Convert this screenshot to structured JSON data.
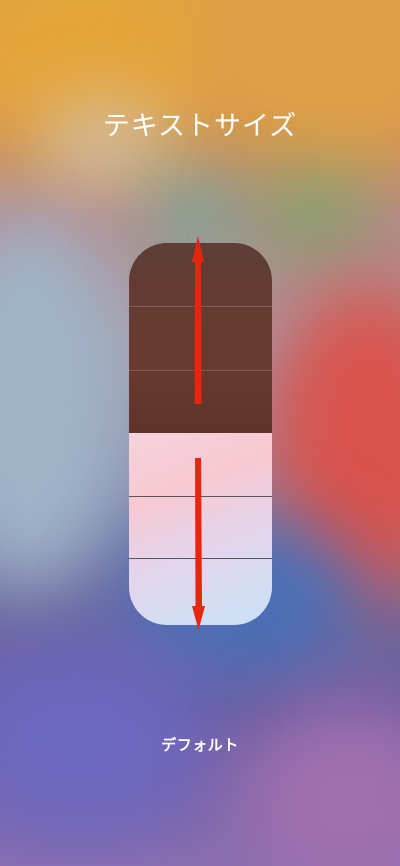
{
  "title": "テキストサイズ",
  "slider": {
    "current_level": "デフォルト",
    "annotation_color": "#e8260f"
  }
}
